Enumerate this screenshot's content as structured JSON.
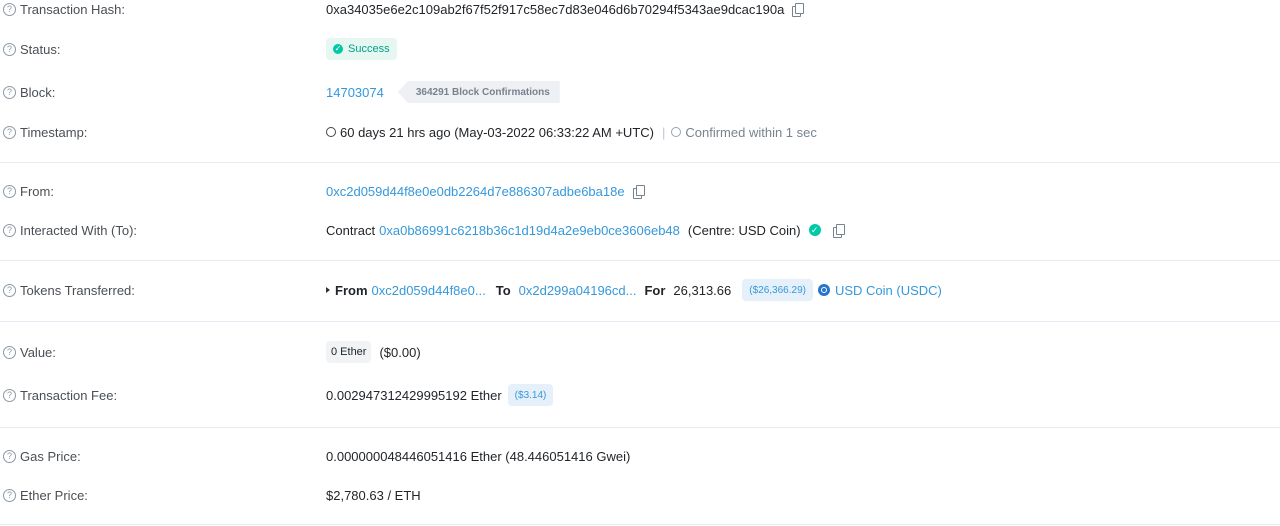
{
  "tx_hash": {
    "label": "Transaction Hash:",
    "value": "0xa34035e6e2c109ab2f67f52f917c58ec7d83e046d6b70294f5343ae9dcac190a"
  },
  "status": {
    "label": "Status:",
    "value": "Success"
  },
  "block": {
    "label": "Block:",
    "number": "14703074",
    "confirmations": "364291 Block Confirmations"
  },
  "timestamp": {
    "label": "Timestamp:",
    "value": "60 days 21 hrs ago (May-03-2022 06:33:22 AM +UTC)",
    "separator": "|",
    "confirmed": "Confirmed within 1 sec"
  },
  "from": {
    "label": "From:",
    "value": "0xc2d059d44f8e0e0db2264d7e886307adbe6ba18e"
  },
  "interacted": {
    "label": "Interacted With (To):",
    "prefix": "Contract",
    "address": "0xa0b86991c6218b36c1d19d4a2e9eb0ce3606eb48",
    "name": "(Centre: USD Coin)"
  },
  "tokens": {
    "label": "Tokens Transferred:",
    "from_label": "From",
    "from_addr": "0xc2d059d44f8e0...",
    "to_label": "To",
    "to_addr": "0x2d299a04196cd...",
    "for_label": "For",
    "amount": "26,313.66",
    "usd": "($26,366.29)",
    "token": "USD Coin (USDC)"
  },
  "value": {
    "label": "Value:",
    "ether": "0 Ether",
    "usd": "($0.00)"
  },
  "fee": {
    "label": "Transaction Fee:",
    "value": "0.002947312429995192 Ether",
    "usd": "($3.14)"
  },
  "gas_price": {
    "label": "Gas Price:",
    "value": "0.000000048446051416 Ether (48.446051416 Gwei)"
  },
  "ether_price": {
    "label": "Ether Price:",
    "value": "$2,780.63 / ETH"
  },
  "help_glyph": "?",
  "check_glyph": "✓"
}
